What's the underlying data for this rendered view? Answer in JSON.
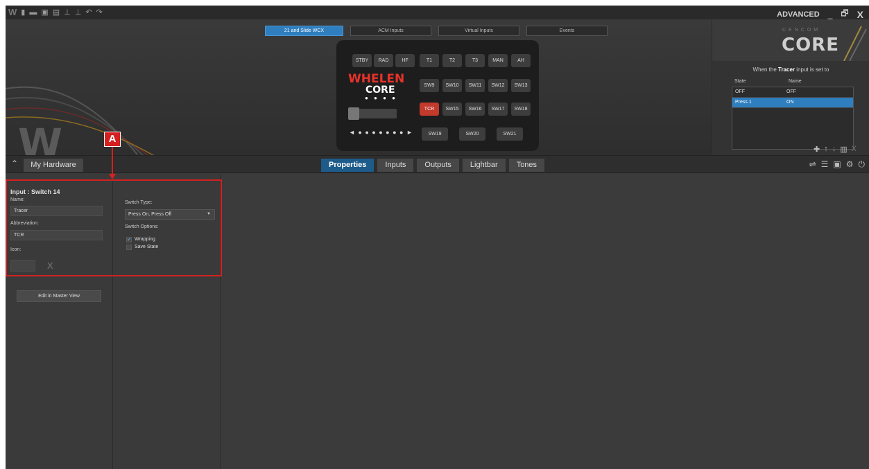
{
  "titlebar": {
    "icons": [
      "whelen-logo-icon",
      "new-file-icon",
      "open-folder-icon",
      "save-icon",
      "print-icon",
      "upload-icon",
      "download-icon",
      "undo-icon",
      "redo-icon"
    ],
    "mode_label": "ADVANCED",
    "minimize": "_",
    "restore": "🗗",
    "close": "X"
  },
  "config_tabs": [
    "21 and Slide WCX",
    "ACM Inputs",
    "Virtual Inputs",
    "Events"
  ],
  "active_config_tab": "21 and Slide WCX",
  "controller": {
    "top_row": [
      "STBY",
      "RAD",
      "HF",
      "T1",
      "T2",
      "T3",
      "MAN",
      "AH"
    ],
    "row2": [
      "SW9",
      "SW10",
      "SW11",
      "SW12",
      "SW13"
    ],
    "row3": [
      "TCR",
      "SW15",
      "SW16",
      "SW17",
      "SW18"
    ],
    "row4": [
      "SW19",
      "SW20",
      "SW21"
    ],
    "selected_button": "TCR",
    "logo_top": "WHELEN",
    "logo_bottom": "CORE",
    "logo_dots": "● ● ● ●",
    "dots_row": "◄ ● ● ● ● ● ● ● ►"
  },
  "brand": {
    "small": "CENCOM",
    "big": "CORE"
  },
  "right_panel": {
    "title_prefix": "When the",
    "title_bold": "Tracer",
    "title_suffix": "input is set to",
    "col_state": "State",
    "col_name": "Name",
    "rows": [
      {
        "state": "OFF",
        "name": "OFF"
      },
      {
        "state": "Press 1",
        "name": "ON"
      }
    ],
    "selected_row": 1
  },
  "toolbar": {
    "collapse": "⌃",
    "hardware_button": "My Hardware",
    "tabs": [
      "Properties",
      "Inputs",
      "Outputs",
      "Lightbar",
      "Tones"
    ],
    "active_tab": "Properties"
  },
  "input_panel": {
    "title": "Input : Switch 14",
    "name_label": "Name:",
    "name_value": "Tracer",
    "abbrev_label": "Abbreviation:",
    "abbrev_value": "TCR",
    "icon_label": "Icon:",
    "icon_clear": "X",
    "edit_button": "Edit in Master View"
  },
  "switch_panel": {
    "type_label": "Switch Type:",
    "type_value": "Press On, Press Off",
    "options_label": "Switch Options:",
    "options": [
      {
        "label": "Wrapping",
        "checked": true
      },
      {
        "label": "Save State",
        "checked": false
      }
    ]
  },
  "annotation": {
    "label": "A"
  }
}
